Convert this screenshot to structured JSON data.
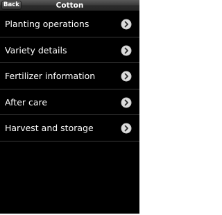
{
  "header": {
    "back_label": "Back",
    "title": "Cotton"
  },
  "menu": {
    "items": [
      {
        "label": "Planting operations",
        "icon": "chevron-right-circle-icon"
      },
      {
        "label": "Variety details",
        "icon": "chevron-right-circle-icon"
      },
      {
        "label": "Fertilizer information",
        "icon": "chevron-right-circle-icon"
      },
      {
        "label": "After care",
        "icon": "chevron-right-circle-icon"
      },
      {
        "label": "Harvest and storage",
        "icon": "chevron-right-circle-icon"
      }
    ]
  },
  "colors": {
    "background": "#000000",
    "text": "#ffffff",
    "divider": "#3a3a3a",
    "chevron_fill": "#c8c8c8"
  }
}
